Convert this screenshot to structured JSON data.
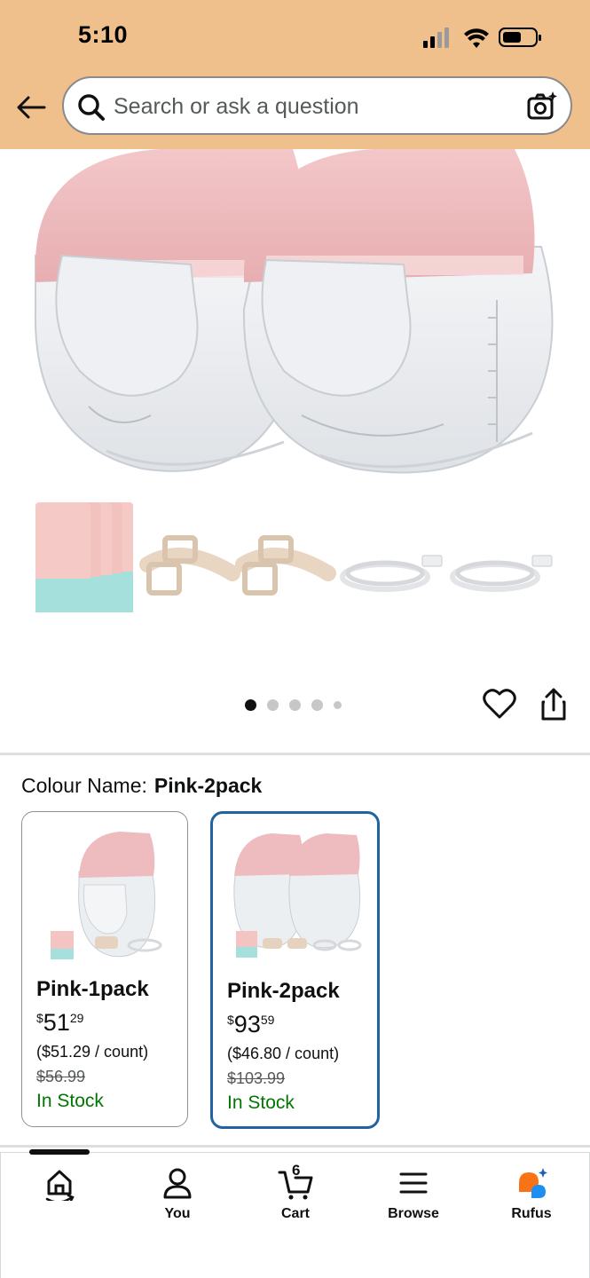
{
  "status_bar": {
    "time": "5:10"
  },
  "search": {
    "placeholder": "Search or ask a question"
  },
  "colour": {
    "label": "Colour Name:",
    "selected": "Pink-2pack"
  },
  "variants": [
    {
      "name": "Pink-1pack",
      "price_symbol": "$",
      "price_whole": "51",
      "price_cents": "29",
      "unit_price": "($51.29 / count)",
      "was_price": "$56.99",
      "stock": "In Stock",
      "selected": false
    },
    {
      "name": "Pink-2pack",
      "price_symbol": "$",
      "price_whole": "93",
      "price_cents": "59",
      "unit_price": "($46.80 / count)",
      "was_price": "$103.99",
      "stock": "In Stock",
      "selected": true
    }
  ],
  "carousel": {
    "count": 5,
    "active_index": 0
  },
  "nav": {
    "items": [
      {
        "label": "",
        "icon": "home-icon"
      },
      {
        "label": "You",
        "icon": "person-icon"
      },
      {
        "label": "Cart",
        "icon": "cart-icon",
        "badge": "6"
      },
      {
        "label": "Browse",
        "icon": "menu-icon"
      },
      {
        "label": "Rufus",
        "icon": "rufus-icon"
      }
    ]
  },
  "colors": {
    "header": "#f0c08c",
    "selected_border": "#2162a1",
    "in_stock": "#007600",
    "pink": "#e8b4b8"
  }
}
